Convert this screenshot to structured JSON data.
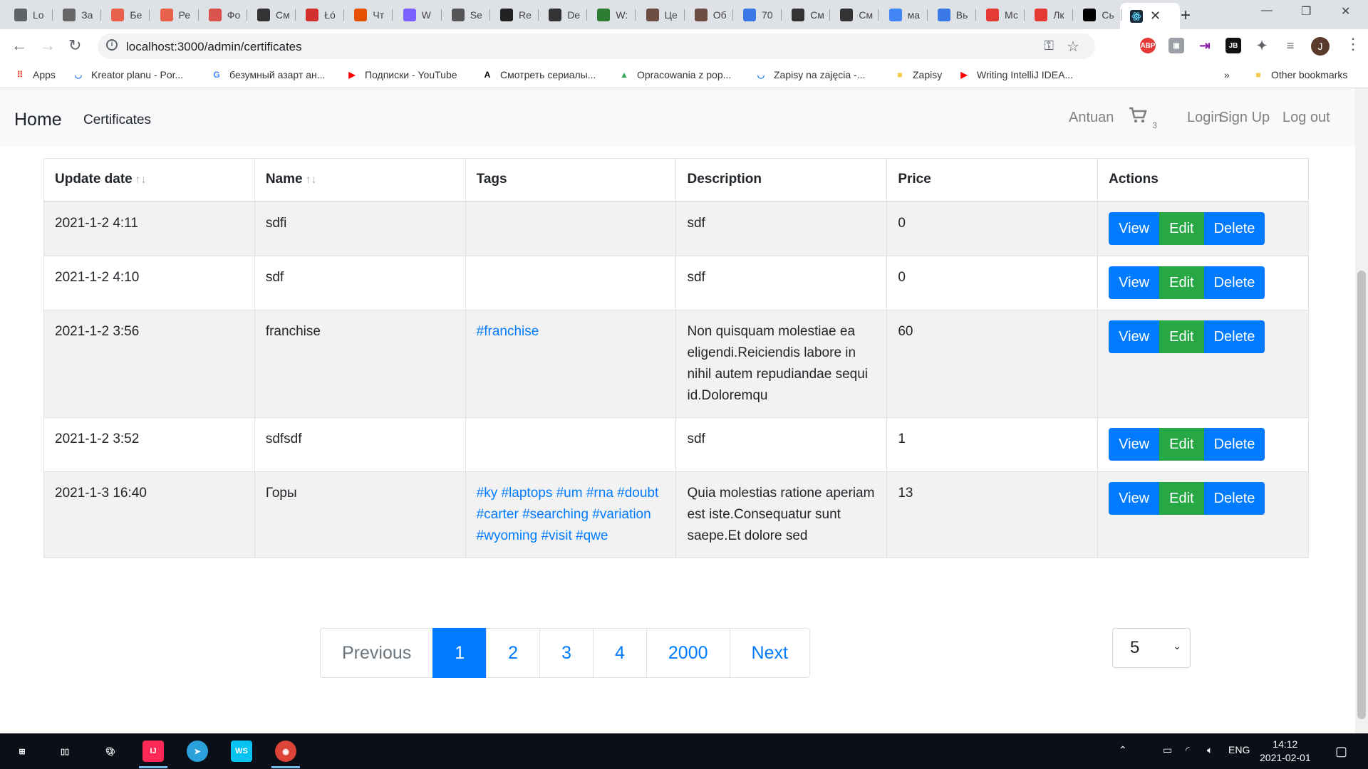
{
  "browser": {
    "tabs": [
      {
        "title": "Lo",
        "icon": "globe-icon",
        "color": "#5f6368"
      },
      {
        "title": "За",
        "icon": "avatar-icon",
        "color": "#666666"
      },
      {
        "title": "Бе",
        "icon": "tur-icon",
        "color": "#e8614a"
      },
      {
        "title": "Ре",
        "icon": "tur-icon",
        "color": "#e8614a"
      },
      {
        "title": "Фо",
        "icon": "puzzle-icon",
        "color": "#d9534f"
      },
      {
        "title": "См",
        "icon": "hd-icon",
        "color": "#333333"
      },
      {
        "title": "Łó",
        "icon": "crest-icon",
        "color": "#d32f2f"
      },
      {
        "title": "Чт",
        "icon": "arrow-icon",
        "color": "#e65100"
      },
      {
        "title": "W",
        "icon": "k-icon",
        "color": "#7b61ff"
      },
      {
        "title": "Se",
        "icon": "io-icon",
        "color": "#555555"
      },
      {
        "title": "Re",
        "icon": "video-icon",
        "color": "#222222"
      },
      {
        "title": "De",
        "icon": "atom-icon",
        "color": "#333333"
      },
      {
        "title": "W:",
        "icon": "w-icon",
        "color": "#2e7d32"
      },
      {
        "title": "Це",
        "icon": "grape-icon",
        "color": "#6d4c41"
      },
      {
        "title": "Об",
        "icon": "grape-icon",
        "color": "#6d4c41"
      },
      {
        "title": "70",
        "icon": "flake-icon",
        "color": "#3b78e7"
      },
      {
        "title": "См",
        "icon": "hd-icon",
        "color": "#333333"
      },
      {
        "title": "См",
        "icon": "hd-icon",
        "color": "#333333"
      },
      {
        "title": "ма",
        "icon": "google-icon",
        "color": "#4285f4"
      },
      {
        "title": "Вь",
        "icon": "flake-icon",
        "color": "#3b78e7"
      },
      {
        "title": "Мс",
        "icon": "t-icon",
        "color": "#e53935"
      },
      {
        "title": "Лк",
        "icon": "t-icon",
        "color": "#e53935"
      },
      {
        "title": "Сь",
        "icon": "lf-icon",
        "color": "#000000"
      }
    ],
    "active_tab": {
      "title": "",
      "icon": "react-icon"
    },
    "url": "localhost:3000/admin/certificates",
    "profile_letter": "J",
    "bookmarks": [
      {
        "label": "Apps",
        "icon": "apps-grid-icon"
      },
      {
        "label": "Kreator planu - Por...",
        "icon": "usos-icon"
      },
      {
        "label": "безумный азарт ан...",
        "icon": "google-icon"
      },
      {
        "label": "Подписки - YouTube",
        "icon": "youtube-icon"
      },
      {
        "label": "Смотреть сериалы...",
        "icon": "a-logo-icon"
      },
      {
        "label": "Opracowania z pop...",
        "icon": "drive-icon"
      },
      {
        "label": "Zapisy na zajęcia -...",
        "icon": "usos-icon"
      },
      {
        "label": "Zapisy",
        "icon": "folder-icon"
      },
      {
        "label": "Writing IntelliJ IDEA...",
        "icon": "youtube-icon"
      }
    ],
    "bookmarks_overflow": "»",
    "other_bookmarks": "Other bookmarks"
  },
  "app": {
    "brand": "Home",
    "nav": [
      "Certificates"
    ],
    "user": "Antuan",
    "cart_count": "3",
    "login": "Login",
    "signup": "Sign Up",
    "logout": "Log out"
  },
  "table": {
    "headers": [
      "Update date",
      "Name",
      "Tags",
      "Description",
      "Price",
      "Actions"
    ],
    "sort_indicator": "↑↓",
    "rows": [
      {
        "date": "2021-1-2 4:11",
        "name": "sdfi",
        "tags": "",
        "description": "sdf",
        "price": "0"
      },
      {
        "date": "2021-1-2 4:10",
        "name": "sdf",
        "tags": "",
        "description": "sdf",
        "price": "0"
      },
      {
        "date": "2021-1-2 3:56",
        "name": "franchise",
        "tags": "#franchise",
        "description": "Non quisquam molestiae ea eligendi.Reiciendis labore in nihil autem repudiandae sequi id.Doloremqu",
        "price": "60"
      },
      {
        "date": "2021-1-2 3:52",
        "name": "sdfsdf",
        "tags": "",
        "description": "sdf",
        "price": "1"
      },
      {
        "date": "2021-1-3 16:40",
        "name": "Горы",
        "tags": "#ky #laptops #um #rna #doubt #carter #searching #variation #wyoming #visit #qwe",
        "description": "Quia molestias ratione aperiam est iste.Consequatur sunt saepe.Et dolore sed",
        "price": "13"
      }
    ],
    "actions": {
      "view": "View",
      "edit": "Edit",
      "delete": "Delete"
    }
  },
  "pagination": {
    "previous": "Previous",
    "pages": [
      "1",
      "2",
      "3",
      "4",
      "2000"
    ],
    "current": "1",
    "next": "Next"
  },
  "page_size": {
    "value": "5"
  },
  "taskbar": {
    "apps": [
      {
        "icon": "start-icon"
      },
      {
        "icon": "task-view-icon"
      },
      {
        "icon": "paint-icon"
      },
      {
        "icon": "intellij-icon"
      },
      {
        "icon": "telegram-icon"
      },
      {
        "icon": "webstorm-icon"
      },
      {
        "icon": "chrome-icon"
      }
    ],
    "lang": "ENG",
    "time": "14:12",
    "date": "2021-02-01"
  },
  "colors": {
    "primary": "#007bff",
    "success": "#28a745"
  }
}
